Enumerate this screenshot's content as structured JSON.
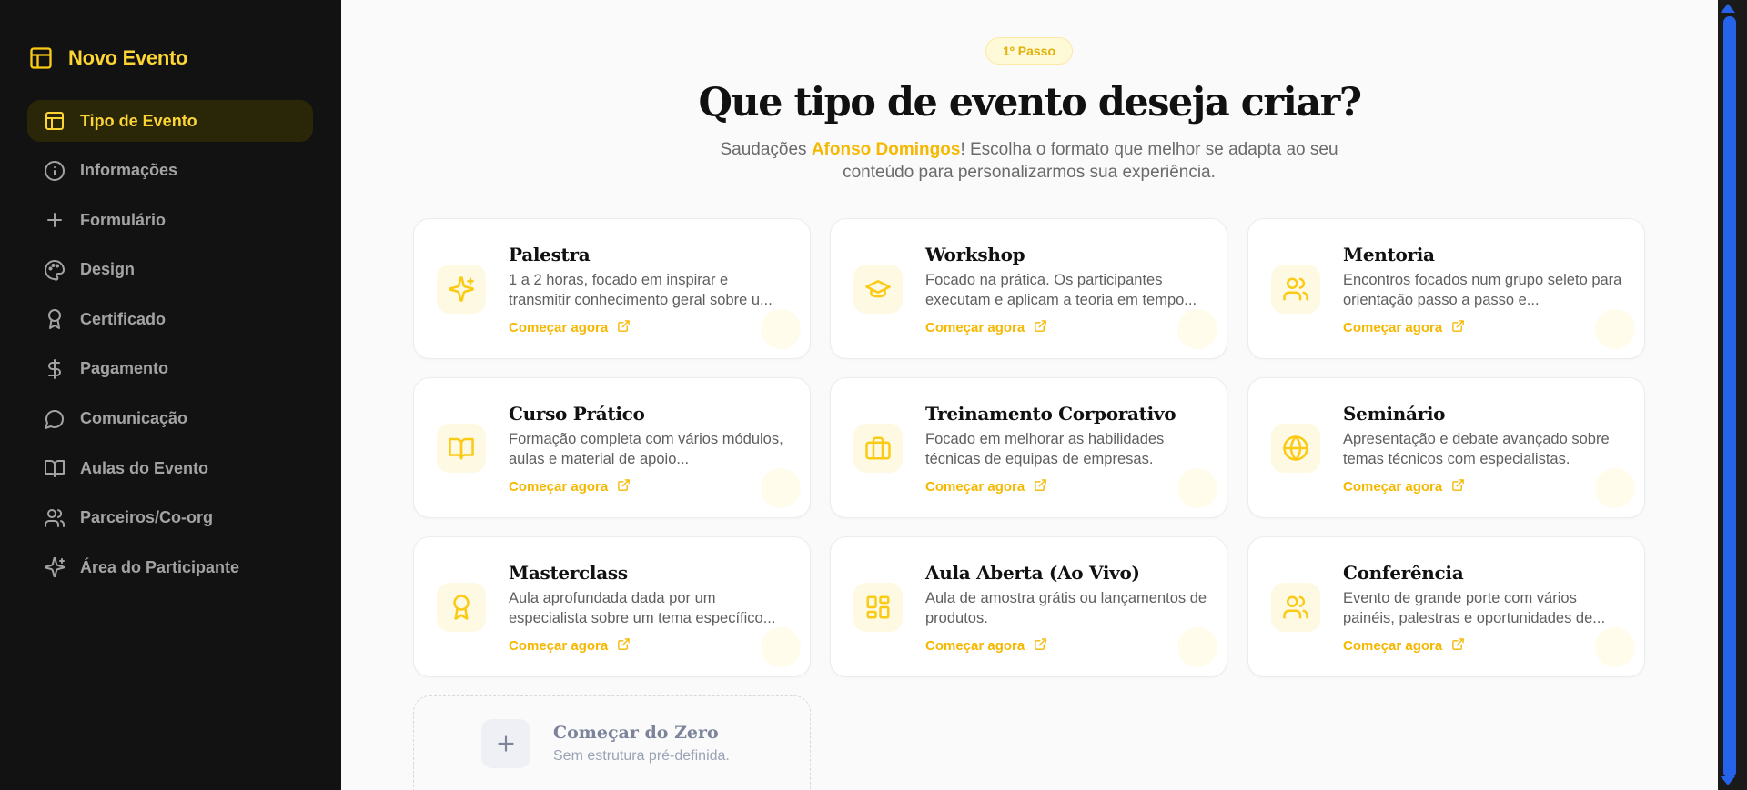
{
  "brand": {
    "title": "Novo Evento",
    "icon": "layout-icon"
  },
  "sidebar": {
    "items": [
      {
        "label": "Tipo de Evento",
        "icon": "layout",
        "active": true
      },
      {
        "label": "Informações",
        "icon": "info"
      },
      {
        "label": "Formulário",
        "icon": "plus"
      },
      {
        "label": "Design",
        "icon": "palette"
      },
      {
        "label": "Certificado",
        "icon": "award"
      },
      {
        "label": "Pagamento",
        "icon": "dollar"
      },
      {
        "label": "Comunicação",
        "icon": "message"
      },
      {
        "label": "Aulas do Evento",
        "icon": "book"
      },
      {
        "label": "Parceiros/Co-org",
        "icon": "users"
      },
      {
        "label": "Área do Participante",
        "icon": "sparkles"
      }
    ]
  },
  "main": {
    "badge": "1º Passo",
    "heading": "Que tipo de evento deseja criar?",
    "subtitle_prefix": "Saudações ",
    "user_name": "Afonso Domingos",
    "subtitle_suffix": "! Escolha o formato que melhor se adapta ao seu conteúdo para personalizarmos sua experiência.",
    "cta_label": "Começar agora",
    "cards": [
      {
        "title": "Palestra",
        "desc": "1 a 2 horas, focado em inspirar e transmitir conhecimento geral sobre u...",
        "icon": "sparkles"
      },
      {
        "title": "Workshop",
        "desc": "Focado na prática. Os participantes executam e aplicam a teoria em tempo...",
        "icon": "graduation-cap"
      },
      {
        "title": "Mentoria",
        "desc": "Encontros focados num grupo seleto para orientação passo a passo e...",
        "icon": "users"
      },
      {
        "title": "Curso Prático",
        "desc": "Formação completa com vários módulos, aulas e material de apoio...",
        "icon": "book"
      },
      {
        "title": "Treinamento Corporativo",
        "desc": "Focado em melhorar as habilidades técnicas de equipas de empresas.",
        "icon": "briefcase"
      },
      {
        "title": "Seminário",
        "desc": "Apresentação e debate avançado sobre temas técnicos com especialistas.",
        "icon": "globe"
      },
      {
        "title": "Masterclass",
        "desc": "Aula aprofundada dada por um especialista sobre um tema específico...",
        "icon": "award"
      },
      {
        "title": "Aula Aberta (Ao Vivo)",
        "desc": "Aula de amostra grátis ou lançamentos de produtos.",
        "icon": "dashboard"
      },
      {
        "title": "Conferência",
        "desc": "Evento de grande porte com vários painéis, palestras e oportunidades de...",
        "icon": "users"
      }
    ],
    "zero": {
      "title": "Começar do Zero",
      "subtitle": "Sem estrutura pré-definida.",
      "icon": "plus"
    }
  },
  "colors": {
    "accent": "#FACC15",
    "accent_text": "#F5B800",
    "sidebar_bg": "#121212",
    "scroll_thumb": "#2563EB"
  }
}
